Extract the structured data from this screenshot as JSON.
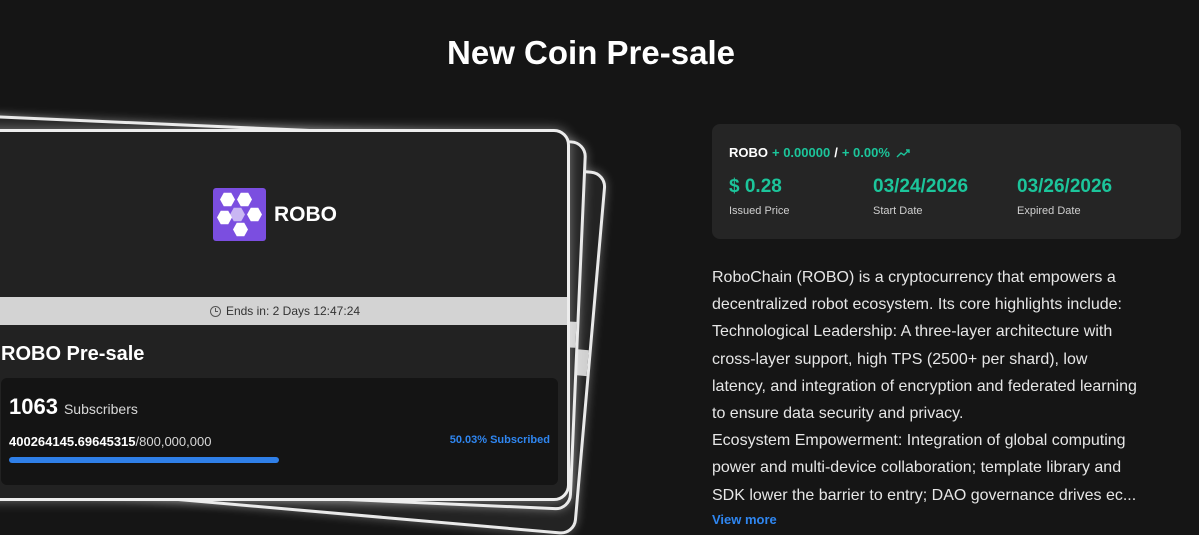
{
  "page": {
    "title": "New Coin Pre-sale"
  },
  "card": {
    "coin_symbol": "ROBO",
    "logo_icon": "robo-hexagon-logo",
    "logo_color": "#7b4ee0",
    "countdown": "Ends in: 2 Days 12:47:24",
    "title": "ROBO Pre-sale",
    "subscribers_count": "1063",
    "subscribers_label": "Subscribers",
    "raised_amount": "400264145.69645315",
    "total_amount": "/800,000,000",
    "subscribed_text": "50.03% Subscribed",
    "progress_fraction": 0.5003
  },
  "info": {
    "symbol": "ROBO",
    "price_change": "+ 0.00000",
    "separator": "/",
    "percent_change": "+ 0.00%",
    "trend_icon": "trend-up-icon",
    "accent_color": "#1cc59b",
    "issued_price": "$ 0.28",
    "issued_price_label": "Issued Price",
    "start_date": "03/24/2026",
    "start_date_label": "Start Date",
    "expired_date": "03/26/2026",
    "expired_date_label": "Expired Date"
  },
  "description": {
    "lines": [
      "RoboChain (ROBO) is a cryptocurrency that empowers a",
      "decentralized robot ecosystem. Its core highlights include:",
      "Technological Leadership: A three-layer architecture with",
      "cross-layer support, high TPS (2500+ per shard), low",
      "latency, and integration of encryption and federated learning",
      "to ensure data security and privacy.",
      "Ecosystem Empowerment: Integration of global computing",
      "power and multi-device collaboration; template library and",
      "SDK lower the barrier to entry; DAO governance drives ec..."
    ],
    "view_more": "View more"
  }
}
